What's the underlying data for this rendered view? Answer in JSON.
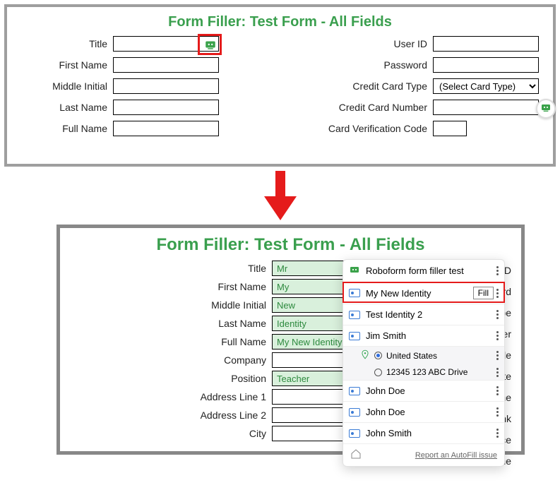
{
  "pageTitle": "Form Filler: Test Form - All Fields",
  "topForm": {
    "leftLabels": [
      "Title",
      "First Name",
      "Middle Initial",
      "Last Name",
      "Full Name"
    ],
    "rightLabels": [
      "User ID",
      "Password",
      "Credit Card Type",
      "Credit Card Number",
      "Card Verification Code"
    ],
    "cardTypePlaceholder": "(Select Card Type)"
  },
  "bottomForm": {
    "labels": [
      "Title",
      "First Name",
      "Middle Initial",
      "Last Name",
      "Full Name",
      "Company",
      "Position",
      "Address Line 1",
      "Address Line 2",
      "City"
    ],
    "values": {
      "Title": "Mr",
      "First Name": "My",
      "Middle Initial": "New",
      "Last Name": "Identity",
      "Full Name": "My New Identity",
      "Company": "",
      "Position": "Teacher",
      "Address Line 1": "",
      "Address Line 2": "",
      "City": ""
    },
    "rightPartialLabels": [
      "ser ID",
      "sword",
      "d Type",
      "umber",
      "Code",
      "n Date",
      "Name",
      "Bank",
      "ervice",
      "Phone"
    ]
  },
  "popup": {
    "header": "Roboform form filler test",
    "items": [
      {
        "name": "My New Identity",
        "fill": true
      },
      {
        "name": "Test Identity 2"
      },
      {
        "name": "Jim Smith",
        "expanded": true,
        "sub": [
          {
            "label": "United States",
            "checked": true,
            "pin": true
          },
          {
            "label": "12345 123 ABC Drive",
            "checked": false
          }
        ]
      },
      {
        "name": "John Doe"
      },
      {
        "name": "John Doe"
      },
      {
        "name": "John Smith"
      }
    ],
    "footerLink": "Report an AutoFill issue"
  }
}
